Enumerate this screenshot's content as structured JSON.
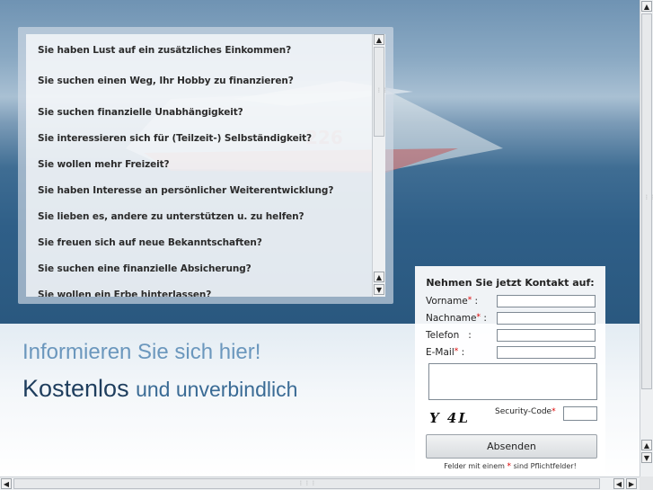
{
  "faq": {
    "items": [
      "Sie haben Lust auf ein zusätzliches Einkommen?",
      "Sie suchen einen Weg, Ihr Hobby zu finanzieren?",
      "Sie suchen finanzielle Unabhängigkeit?",
      "Sie interessieren sich für (Teilzeit-) Selbständigkeit?",
      "Sie wollen mehr Freizeit?",
      "Sie haben Interesse an persönlicher Weiterentwicklung?",
      "Sie lieben es, andere zu unterstützen u. zu helfen?",
      "Sie freuen sich auf neue Bekanntschaften?",
      "Sie suchen eine finanzielle Absicherung?",
      "Sie wollen ein Erbe hinterlassen?"
    ]
  },
  "headings": {
    "info": "Informieren Sie sich hier!",
    "free_strong": "Kostenlos",
    "free_light": "und unverbindlich"
  },
  "boat": {
    "number": "226"
  },
  "contact": {
    "title": "Nehmen Sie jetzt Kontakt auf:",
    "firstname_label": "Vorname",
    "lastname_label": "Nachname",
    "phone_label": "Telefon",
    "email_label": "E-Mail",
    "required_mark": "*",
    "colon": ":",
    "captcha_text": "Y 4L",
    "security_label": "Security-Code",
    "submit_label": "Absenden",
    "note_before": "Felder mit einem",
    "note_after": "sind Pflichtfelder!"
  },
  "colors": {
    "heading_light": "#6b97bd",
    "heading_dark": "#1f3e5e",
    "required": "#dd0000"
  }
}
